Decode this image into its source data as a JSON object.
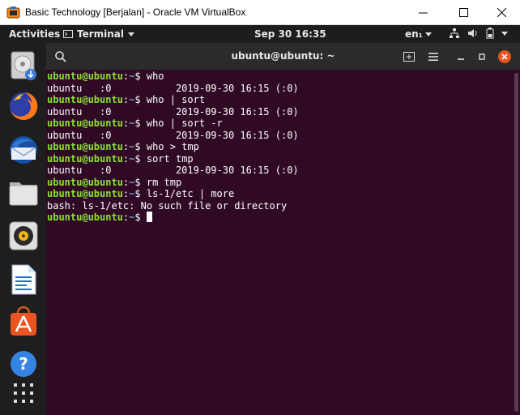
{
  "window": {
    "title": "Basic Technology [Berjalan] - Oracle VM VirtualBox",
    "icon": "virtualbox-icon",
    "buttons": [
      "minimize-icon",
      "maximize-icon",
      "close-icon"
    ]
  },
  "topbar": {
    "activities": "Activities",
    "app_menu": "Terminal",
    "clock": "Sep 30  16:35",
    "language": "en₁",
    "status_icons": [
      "network-icon",
      "volume-icon",
      "battery-icon",
      "power-icon"
    ]
  },
  "dock": {
    "items": [
      {
        "name": "installer-icon"
      },
      {
        "name": "firefox-icon"
      },
      {
        "name": "thunderbird-icon"
      },
      {
        "name": "files-icon"
      },
      {
        "name": "rhythmbox-icon"
      },
      {
        "name": "libreoffice-writer-icon"
      },
      {
        "name": "software-center-icon"
      },
      {
        "name": "help-icon"
      },
      {
        "name": "show-applications-icon"
      }
    ]
  },
  "terminal": {
    "title": "ubuntu@ubuntu: ~",
    "prompt_user": "ubuntu@ubuntu",
    "prompt_sep": ":",
    "prompt_path": "~",
    "prompt_end": "$ ",
    "lines": [
      {
        "type": "cmd",
        "text": "who"
      },
      {
        "type": "out",
        "text": "ubuntu   :0           2019-09-30 16:15 (:0)"
      },
      {
        "type": "cmd",
        "text": "who | sort"
      },
      {
        "type": "out",
        "text": "ubuntu   :0           2019-09-30 16:15 (:0)"
      },
      {
        "type": "cmd",
        "text": "who | sort -r"
      },
      {
        "type": "out",
        "text": "ubuntu   :0           2019-09-30 16:15 (:0)"
      },
      {
        "type": "cmd",
        "text": "who > tmp"
      },
      {
        "type": "cmd",
        "text": "sort tmp"
      },
      {
        "type": "out",
        "text": "ubuntu   :0           2019-09-30 16:15 (:0)"
      },
      {
        "type": "cmd",
        "text": "rm tmp"
      },
      {
        "type": "cmd",
        "text": "ls-1/etc | more"
      },
      {
        "type": "out",
        "text": "bash: ls-1/etc: No such file or directory"
      },
      {
        "type": "cursor",
        "text": ""
      }
    ]
  },
  "colors": {
    "terminal_bg": "#300a24",
    "prompt_user": "#8ae234",
    "prompt_path": "#729fcf",
    "header_bg": "#2b2b2b",
    "close_button": "#e95420"
  }
}
